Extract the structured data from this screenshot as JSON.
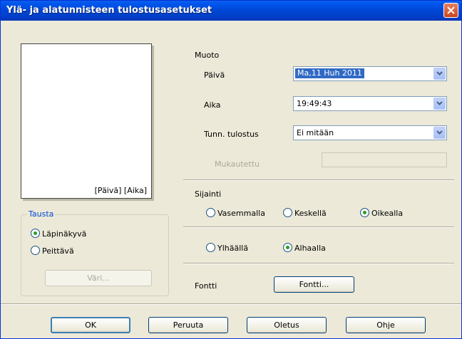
{
  "window": {
    "title": "Ylä- ja alatunnisteen tulostusasetukset"
  },
  "preview": {
    "text": "[Päivä] [Aika]"
  },
  "background": {
    "legend": "Tausta",
    "options": [
      {
        "label": "Läpinäkyvä",
        "selected": true
      },
      {
        "label": "Peittävä",
        "selected": false
      }
    ],
    "color_button": "Väri..."
  },
  "format": {
    "heading": "Muoto",
    "date_label": "Päivä",
    "date_value": "Ma,11 Huh 2011",
    "time_label": "Aika",
    "time_value": "19:49:43",
    "id_label": "Tunn. tulostus",
    "id_value": "Ei mitään",
    "custom_label": "Mukautettu",
    "custom_value": ""
  },
  "position": {
    "heading": "Sijainti",
    "horizontal": [
      {
        "label": "Vasemmalla",
        "selected": false
      },
      {
        "label": "Keskellä",
        "selected": false
      },
      {
        "label": "Oikealla",
        "selected": true
      }
    ],
    "vertical": [
      {
        "label": "Ylhäällä",
        "selected": false
      },
      {
        "label": "Alhaalla",
        "selected": true
      }
    ]
  },
  "font": {
    "label": "Fontti",
    "button": "Fontti..."
  },
  "buttons": {
    "ok": "OK",
    "cancel": "Peruuta",
    "default": "Oletus",
    "help": "Ohje"
  },
  "colors": {
    "titlebar": "#0046d5",
    "dialog_bg": "#ece9d8",
    "selection": "#316ac5",
    "close": "#c94520"
  }
}
